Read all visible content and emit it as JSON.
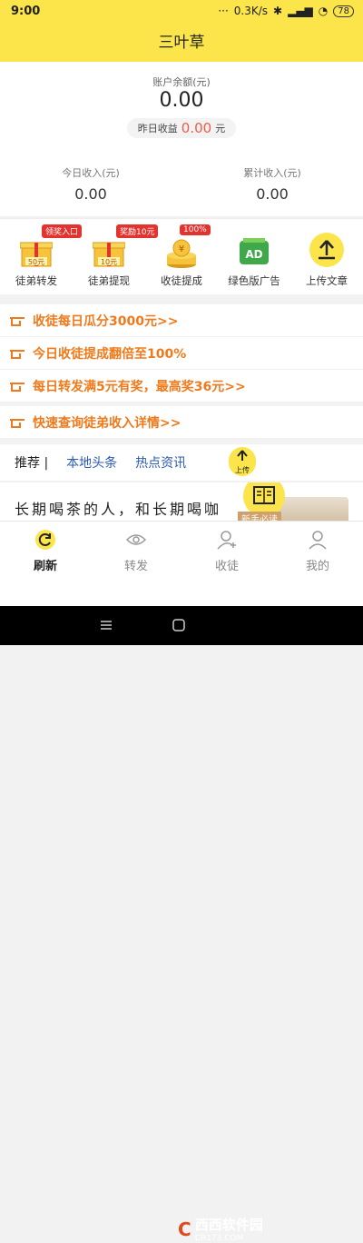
{
  "status": {
    "time": "9:00",
    "net_speed": "0.3K/s",
    "battery": "78"
  },
  "title": "三叶草",
  "balance": {
    "label": "账户余额(元)",
    "value": "0.00",
    "yesterday_label": "昨日收益",
    "yesterday_value": "0.00",
    "yesterday_unit": "元"
  },
  "stats": [
    {
      "label": "今日收入(元)",
      "value": "0.00"
    },
    {
      "label": "累计收入(元)",
      "value": "0.00"
    }
  ],
  "icons": [
    {
      "label": "徒弟转发",
      "badge": "领奖入口",
      "tag": "50元"
    },
    {
      "label": "徒弟提现",
      "badge": "奖励10元",
      "tag": "10元"
    },
    {
      "label": "收徒提成",
      "badge": "100%"
    },
    {
      "label": "绿色版广告",
      "inner": "AD"
    },
    {
      "label": "上传文章"
    }
  ],
  "promos": [
    "收徒每日瓜分3000元>>",
    "今日收徒提成翻倍至100%",
    "每日转发满5元有奖，最高奖36元>>",
    "快速查询徒弟收入详情>>"
  ],
  "recommend": {
    "label": "推荐 |",
    "tabs": [
      "本地头条",
      "热点资讯"
    ],
    "upload_label": "上传"
  },
  "article": {
    "title": "长期喝茶的人，和长期喝咖",
    "ribbon": "新手必读"
  },
  "tabbar": [
    {
      "label": "刷新",
      "active": true
    },
    {
      "label": "转发",
      "active": false
    },
    {
      "label": "收徒",
      "active": false
    },
    {
      "label": "我的",
      "active": false
    }
  ],
  "watermark": {
    "brand": "西西软件园",
    "site": "CR173.COM"
  },
  "colors": {
    "accent_yellow": "#fbe54a",
    "promo_orange": "#f07a1b",
    "link_blue": "#2b5bb6",
    "badge_red": "#e3332f"
  }
}
